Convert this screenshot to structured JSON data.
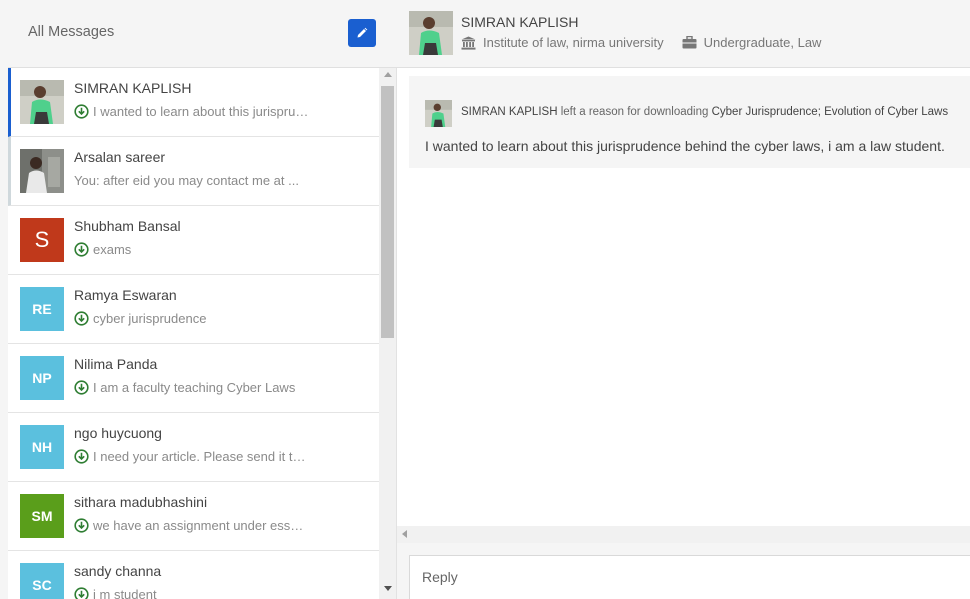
{
  "inbox": {
    "title": "All Messages",
    "compose_icon": "pencil-icon"
  },
  "conversations": [
    {
      "name": "SIMRAN KAPLISH",
      "preview": "I wanted to learn about this jurisprudence behind the cyber laws, i am a law student.",
      "has_download_icon": true,
      "avatar_type": "photo",
      "state": "active"
    },
    {
      "name": "Arsalan sareer",
      "preview": "You: after eid you may contact me at ...",
      "has_download_icon": false,
      "avatar_type": "photo",
      "state": "unread"
    },
    {
      "name": "Shubham Bansal",
      "preview": "exams",
      "has_download_icon": true,
      "avatar_initials": "S",
      "avatar_color": "#c0391b"
    },
    {
      "name": "Ramya Eswaran",
      "preview": "cyber jurisprudence",
      "has_download_icon": true,
      "avatar_initials": "RE",
      "avatar_color": "#5bc0de"
    },
    {
      "name": "Nilima Panda",
      "preview": "I am a faculty teaching Cyber Laws",
      "has_download_icon": true,
      "avatar_initials": "NP",
      "avatar_color": "#5bc0de"
    },
    {
      "name": "ngo huycuong",
      "preview": "I need your article. Please send it to me.",
      "has_download_icon": true,
      "avatar_initials": "NH",
      "avatar_color": "#5bc0de"
    },
    {
      "name": "sithara madubhashini",
      "preview": "we have an assignment under essay writing",
      "has_download_icon": true,
      "avatar_initials": "SM",
      "avatar_color": "#5a9e1b"
    },
    {
      "name": "sandy channa",
      "preview": "i m student",
      "has_download_icon": true,
      "avatar_initials": "SC",
      "avatar_color": "#5bc0de"
    }
  ],
  "contact": {
    "name": "SIMRAN KAPLISH",
    "institution": "Institute of law, nirma university",
    "institution_icon": "institution-icon",
    "degree": "Undergraduate, Law",
    "degree_icon": "briefcase-icon"
  },
  "message": {
    "sender": "SIMRAN KAPLISH",
    "action_text": "left a reason for downloading",
    "document": "Cyber Jurisprudence; Evolution of Cyber Laws",
    "body": "I wanted to learn about this jurisprudence behind the cyber laws, i am a law student."
  },
  "reply": {
    "placeholder": "Reply"
  },
  "colors": {
    "accent": "#1a5fd0",
    "download_icon": "#2e7d32"
  }
}
